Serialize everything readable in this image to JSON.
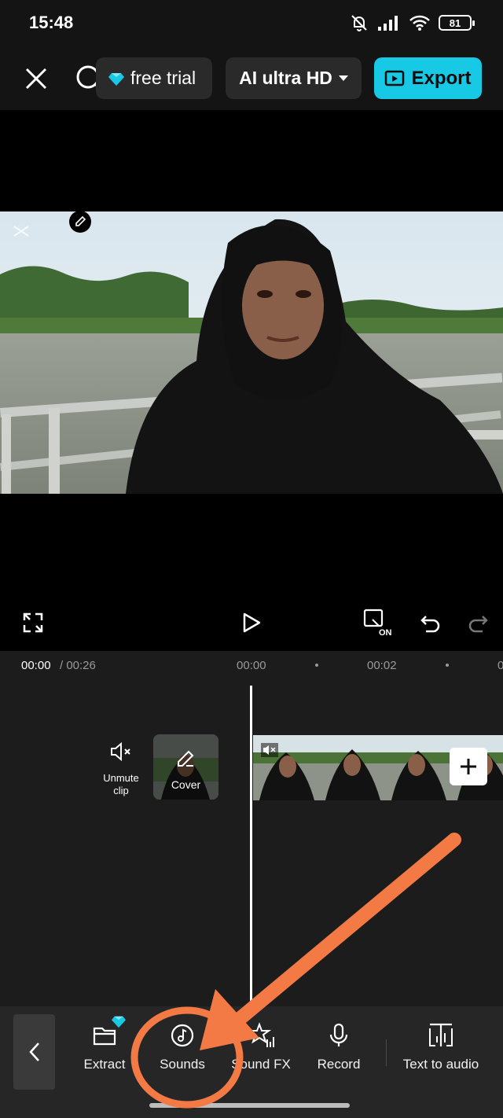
{
  "status_bar": {
    "time": "15:48",
    "battery": "81"
  },
  "top_bar": {
    "trial_label": "free trial",
    "quality_label": "AI ultra HD",
    "export_label": "Export"
  },
  "timeline": {
    "current_time": "00:00",
    "total_time": "/ 00:26",
    "ruler": [
      "00:00",
      "00:02",
      "0"
    ],
    "unmute_label": "Unmute clip",
    "cover_label": "Cover"
  },
  "toolbar": {
    "items": [
      {
        "label": "Extract",
        "icon": "folder-icon",
        "premium": true
      },
      {
        "label": "Sounds",
        "icon": "music-disc-icon",
        "premium": false
      },
      {
        "label": "Sound FX",
        "icon": "sound-fx-icon",
        "premium": false
      },
      {
        "label": "Record",
        "icon": "microphone-icon",
        "premium": false
      },
      {
        "label": "Text to audio",
        "icon": "text-to-audio-icon",
        "premium": false
      }
    ]
  },
  "colors": {
    "accent": "#18c9e6",
    "annotation": "#f47a45",
    "background": "#000000",
    "timeline_bg": "#1c1c1c",
    "toolbar_bg": "#262626"
  }
}
